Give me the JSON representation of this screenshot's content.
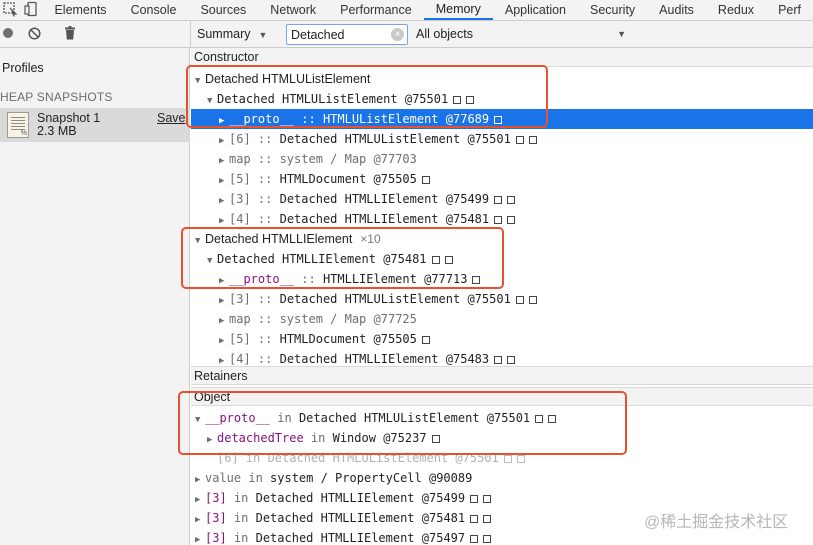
{
  "tabs": [
    "Elements",
    "Console",
    "Sources",
    "Network",
    "Performance",
    "Memory",
    "Application",
    "Security",
    "Audits",
    "Redux",
    "Perf"
  ],
  "selected_tab": "Memory",
  "toolbar": {
    "view_select": "Summary",
    "filter_value": "Detached",
    "objects_select": "All objects"
  },
  "sidebar": {
    "profiles_label": "Profiles",
    "heap_snapshots_label": "HEAP SNAPSHOTS",
    "snapshot": {
      "name": "Snapshot 1",
      "size": "2.3 MB",
      "save": "Save",
      "icon_badge": "%"
    }
  },
  "sections": {
    "constructor": "Constructor",
    "retainers": "Retainers",
    "object": "Object"
  },
  "constructor_rows": [
    {
      "indent": 0,
      "tri": "▼",
      "sans": "Detached HTMLUListElement"
    },
    {
      "indent": 1,
      "tri": "▼",
      "name": "Detached HTMLUListElement",
      "id": "@75501",
      "squares": 2
    },
    {
      "indent": 2,
      "tri": "▶",
      "prop": "__proto__",
      "sep": " :: ",
      "name": "HTMLUListElement",
      "id": "@77689",
      "squares": 1,
      "selected": true
    },
    {
      "indent": 2,
      "tri": "▶",
      "mut": "[6]",
      "sep": " :: ",
      "name": "Detached HTMLUListElement",
      "id": "@75501",
      "squares": 2
    },
    {
      "indent": 2,
      "tri": "▶",
      "mut": "map :: system / Map",
      "id": "@77703",
      "squares": 0,
      "mutid": true
    },
    {
      "indent": 2,
      "tri": "▶",
      "mut": "[5]",
      "sep": " :: ",
      "name": "HTMLDocument",
      "id": "@75505",
      "squares": 1
    },
    {
      "indent": 2,
      "tri": "▶",
      "mut": "[3]",
      "sep": " :: ",
      "name": "Detached HTMLLIElement",
      "id": "@75499",
      "squares": 2
    },
    {
      "indent": 2,
      "tri": "▶",
      "mut": "[4]",
      "sep": " :: ",
      "name": "Detached HTMLLIElement",
      "id": "@75481",
      "squares": 2
    },
    {
      "indent": 0,
      "tri": "▼",
      "sans": "Detached HTMLLIElement",
      "count": "×10"
    },
    {
      "indent": 1,
      "tri": "▼",
      "name": "Detached HTMLLIElement",
      "id": "@75481",
      "squares": 2
    },
    {
      "indent": 2,
      "tri": "▶",
      "prop": "__proto__",
      "sep": " :: ",
      "name": "HTMLLIElement",
      "id": "@77713",
      "squares": 1
    },
    {
      "indent": 2,
      "tri": "▶",
      "mut": "[3]",
      "sep": " :: ",
      "name": "Detached HTMLUListElement",
      "id": "@75501",
      "squares": 2
    },
    {
      "indent": 2,
      "tri": "▶",
      "mut": "map :: system / Map",
      "id": "@77725",
      "squares": 0,
      "mutid": true
    },
    {
      "indent": 2,
      "tri": "▶",
      "mut": "[5]",
      "sep": " :: ",
      "name": "HTMLDocument",
      "id": "@75505",
      "squares": 1
    },
    {
      "indent": 2,
      "tri": "▶",
      "mut": "[4]",
      "sep": " :: ",
      "name": "Detached HTMLLIElement",
      "id": "@75483",
      "squares": 2
    }
  ],
  "retainer_rows": [
    {
      "indent": 0,
      "tri": "▼",
      "prop": "__proto__",
      "sep": " in ",
      "name": "Detached HTMLUListElement",
      "id": "@75501",
      "squares": 2
    },
    {
      "indent": 1,
      "tri": "▶",
      "prop": "detachedTree",
      "sep": " in ",
      "name": "Window",
      "id": "@75237",
      "squares": 1
    },
    {
      "indent": 1,
      "tri": "",
      "faded": true,
      "text": "[6] in Detached HTMLUListElement @75501",
      "squares": 2
    },
    {
      "indent": 0,
      "tri": "▶",
      "mut": "value",
      "sep": " in ",
      "name": "system / PropertyCell",
      "id": "@90089",
      "squares": 0
    },
    {
      "indent": 0,
      "tri": "▶",
      "prop": "[3]",
      "sep": " in ",
      "name": "Detached HTMLLIElement",
      "id": "@75499",
      "squares": 2
    },
    {
      "indent": 0,
      "tri": "▶",
      "prop": "[3]",
      "sep": " in ",
      "name": "Detached HTMLLIElement",
      "id": "@75481",
      "squares": 2
    },
    {
      "indent": 0,
      "tri": "▶",
      "prop": "[3]",
      "sep": " in ",
      "name": "Detached HTMLLIElement",
      "id": "@75497",
      "squares": 2
    }
  ],
  "watermark": "@稀土掘金技术社区",
  "colors": {
    "accent": "#1a73e8",
    "annotation": "#e8502e",
    "property": "#881280"
  }
}
